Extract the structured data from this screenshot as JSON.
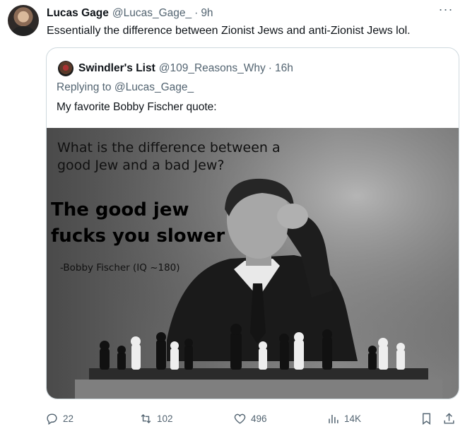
{
  "tweet": {
    "author_name": "Lucas Gage",
    "author_handle": "@Lucas_Gage_",
    "separator": "·",
    "time": "9h",
    "text": "Essentially the difference between Zionist Jews and anti-Zionist Jews lol.",
    "more_label": "···"
  },
  "quoted_tweet": {
    "author_name": "Swindler's List",
    "author_handle": "@109_Reasons_Why",
    "separator": "·",
    "time": "16h",
    "replying_prefix": "Replying to",
    "replying_to": "@Lucas_Gage_",
    "text": "My favorite Bobby Fischer quote:",
    "media": {
      "question": "What is the difference between a good Jew and a bad Jew?",
      "answer": "The good jew fucks you slower",
      "attribution": "-Bobby Fischer (IQ ~180)"
    }
  },
  "actions": {
    "replies": "22",
    "reposts": "102",
    "likes": "496",
    "views": "14K"
  },
  "icons": [
    "reply-icon",
    "repost-icon",
    "like-icon",
    "views-icon",
    "bookmark-icon",
    "share-icon",
    "more-icon"
  ],
  "colors": {
    "text": "#0f1419",
    "secondary": "#536471",
    "border": "#cfd9de"
  }
}
